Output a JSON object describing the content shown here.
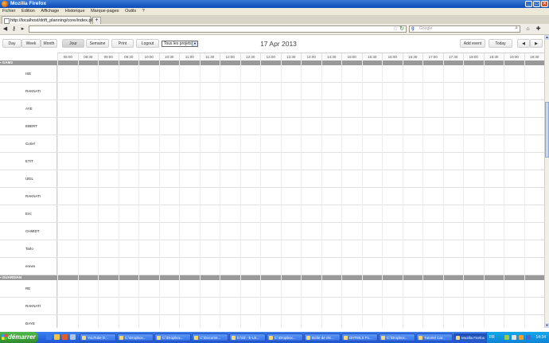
{
  "window": {
    "title": "Mozilla Firefox"
  },
  "menu": [
    "Fichier",
    "Edition",
    "Affichage",
    "Historique",
    "Marque-pages",
    "Outils",
    "?"
  ],
  "tab": {
    "label": "http://localhost/drift_planning/core/index.php"
  },
  "search": {
    "placeholder": "Google"
  },
  "toolbar": {
    "buttons": [
      {
        "label": "Day"
      },
      {
        "label": "Week"
      },
      {
        "label": "Month"
      },
      {
        "label": "Jour"
      },
      {
        "label": "Semaine"
      },
      {
        "label": "Print"
      },
      {
        "label": "Logout"
      },
      {
        "label": "Add event"
      },
      {
        "label": "Today"
      }
    ],
    "project_filter": "Tous les projets",
    "date": "17 Apr 2013"
  },
  "times": [
    "08:00",
    "08:30",
    "09:00",
    "09:30",
    "10:00",
    "10:30",
    "11:00",
    "11:30",
    "12:00",
    "12:30",
    "13:00",
    "13:30",
    "14:00",
    "14:30",
    "15:00",
    "15:30",
    "16:00",
    "16:30",
    "17:00",
    "17:30",
    "18:00",
    "18:30",
    "19:00",
    "19:30"
  ],
  "groups": [
    {
      "label": "GAM3",
      "rows": [
        "ISE",
        "RAKNATI",
        "AYE",
        "EBERT",
        "Coriel",
        "ETIT",
        "UEIL",
        "RAKNATI",
        "Eric",
        "CHMIDT",
        "Tarlo",
        "ennes"
      ]
    },
    {
      "label": "GUARDIAN",
      "rows": [
        "RE",
        "RAKNATI",
        "DAYE"
      ]
    }
  ],
  "taskbar": {
    "start": "démarrer",
    "tasks": [
      "YouTube D...",
      "C:\\Dropbox...",
      "C:\\Dropbox...",
      "C:\\Docume...",
      "E:\\03 - E-LE...",
      "C:\\Dropbox...",
      "Boîte de réc...",
      "DHTMLX Fo...",
      "C:\\Dropbox...",
      "Tutoriel Cal...",
      "Mozilla Firefox"
    ],
    "lang": "FR",
    "clock": "14:34"
  }
}
